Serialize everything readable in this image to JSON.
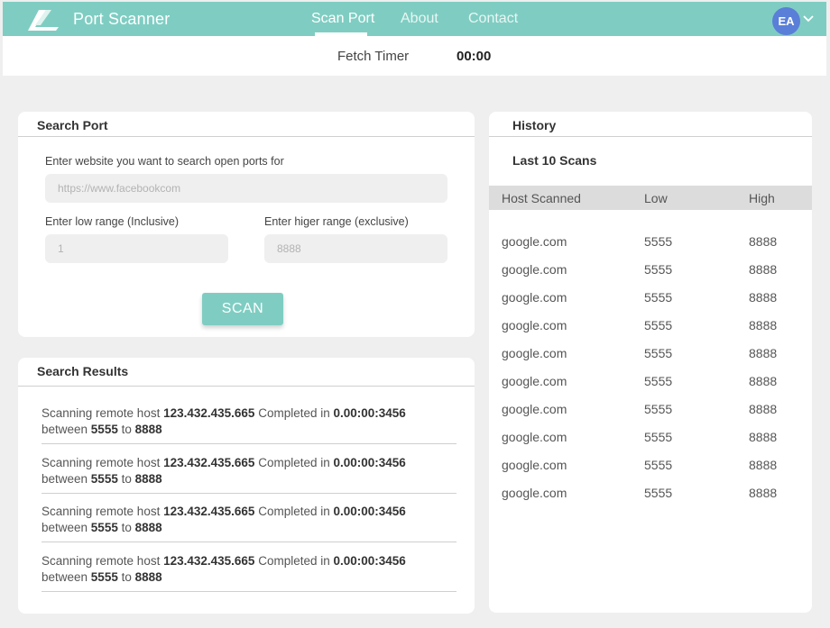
{
  "nav": {
    "brand": "Port Scanner",
    "links": [
      "Scan Port",
      "About",
      "Contact"
    ],
    "avatar_initials": "EA",
    "accent_color": "#7fcdc2"
  },
  "timer": {
    "label": "Fetch Timer",
    "value": "00:00"
  },
  "search": {
    "title": "Search Port",
    "website_label": "Enter website you want to search open ports for",
    "website_placeholder": "https://www.facebookcom",
    "low_label": "Enter low range (Inclusive)",
    "low_placeholder": "1",
    "high_label": "Enter higer range (exclusive)",
    "high_placeholder": "8888",
    "scan_label": "SCAN"
  },
  "results": {
    "title": "Search Results",
    "items": [
      {
        "prefix": "Scanning remote host ",
        "host": "123.432.435.665",
        "mid": " Completed in ",
        "time": "0.00:00:3456",
        "between": "between ",
        "low": "5555",
        "to": " to ",
        "high": "8888"
      },
      {
        "prefix": "Scanning remote host ",
        "host": "123.432.435.665",
        "mid": " Completed in ",
        "time": "0.00:00:3456",
        "between": "between ",
        "low": "5555",
        "to": " to ",
        "high": "8888"
      },
      {
        "prefix": "Scanning remote host ",
        "host": "123.432.435.665",
        "mid": " Completed in ",
        "time": "0.00:00:3456",
        "between": "between ",
        "low": "5555",
        "to": " to ",
        "high": "8888"
      },
      {
        "prefix": "Scanning remote host ",
        "host": "123.432.435.665",
        "mid": " Completed in ",
        "time": "0.00:00:3456",
        "between": "between ",
        "low": "5555",
        "to": " to ",
        "high": "8888"
      }
    ]
  },
  "history": {
    "title": "History",
    "subtitle": "Last 10 Scans",
    "columns": [
      "Host Scanned",
      "Low",
      "High"
    ],
    "rows": [
      [
        "google.com",
        "5555",
        "8888"
      ],
      [
        "google.com",
        "5555",
        "8888"
      ],
      [
        "google.com",
        "5555",
        "8888"
      ],
      [
        "google.com",
        "5555",
        "8888"
      ],
      [
        "google.com",
        "5555",
        "8888"
      ],
      [
        "google.com",
        "5555",
        "8888"
      ],
      [
        "google.com",
        "5555",
        "8888"
      ],
      [
        "google.com",
        "5555",
        "8888"
      ],
      [
        "google.com",
        "5555",
        "8888"
      ],
      [
        "google.com",
        "5555",
        "8888"
      ]
    ]
  }
}
